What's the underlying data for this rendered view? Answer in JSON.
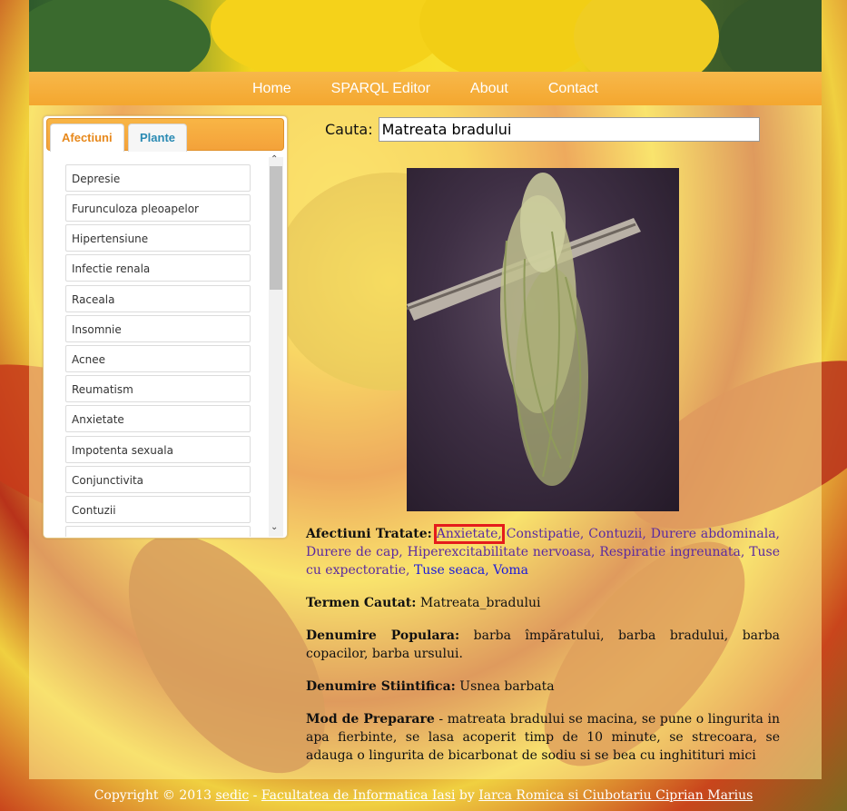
{
  "nav": [
    "Home",
    "SPARQL Editor",
    "About",
    "Contact"
  ],
  "sidebar": {
    "tabs": [
      "Afectiuni",
      "Plante"
    ],
    "items": [
      "Depresie",
      "Furunculoza pleoapelor",
      "Hipertensiune",
      "Infectie renala",
      "Raceala",
      "Insomnie",
      "Acnee",
      "Reumatism",
      "Anxietate",
      "Impotenta sexuala",
      "Conjunctivita",
      "Contuzii"
    ]
  },
  "search": {
    "label": "Cauta:",
    "value": "Matreata bradului"
  },
  "result": {
    "afectiuni_label": "Afectiuni Tratate:",
    "afectiuni": [
      {
        "text": "Anxietate,",
        "color": "purple"
      },
      {
        "text": "Constipatie,",
        "color": "purple"
      },
      {
        "text": "Contuzii,",
        "color": "purple"
      },
      {
        "text": "Durere abdominala,",
        "color": "purple"
      },
      {
        "text": "Durere de cap,",
        "color": "purple"
      },
      {
        "text": "Hiperexcitabilitate nervoasa,",
        "color": "purple"
      },
      {
        "text": "Respiratie ingreunata,",
        "color": "purple"
      },
      {
        "text": "Tuse cu expectoratie,",
        "color": "purple"
      },
      {
        "text": "Tuse seaca,",
        "color": "blue"
      },
      {
        "text": "Voma",
        "color": "blue"
      }
    ],
    "termen_label": "Termen Cautat:",
    "termen_value": "Matreata_bradului",
    "populara_label": "Denumire Populara:",
    "populara_value": "barba împăratului, barba bradului, barba copacilor, barba ursului.",
    "stiintifica_label": "Denumire Stiintifica:",
    "stiintifica_value": "Usnea barbata",
    "preparare_label": "Mod de Preparare",
    "preparare_value": "- matreata bradului se macina, se pune o lingurita in apa fierbinte, se lasa acoperit timp de 10 minute, se strecoara, se adauga o lingurita de bicarbonat de sodiu si se bea cu inghitituri mici"
  },
  "footer": {
    "copyright": "Copyright © 2013",
    "sedic": "sedic",
    "dash": "-",
    "faculty": "Facultatea de Informatica Iasi",
    "by": "by",
    "authors": "Iarca Romica si Ciubotariu Ciprian Marius"
  },
  "colors": {
    "nav_bg": "#f4a72f",
    "tab_active_text": "#e7881b",
    "tab_inactive_text": "#2a8ab3",
    "visited_link": "#5b2aa0",
    "unvisited_link": "#1a1adb",
    "highlight_border": "#e51c1c"
  }
}
